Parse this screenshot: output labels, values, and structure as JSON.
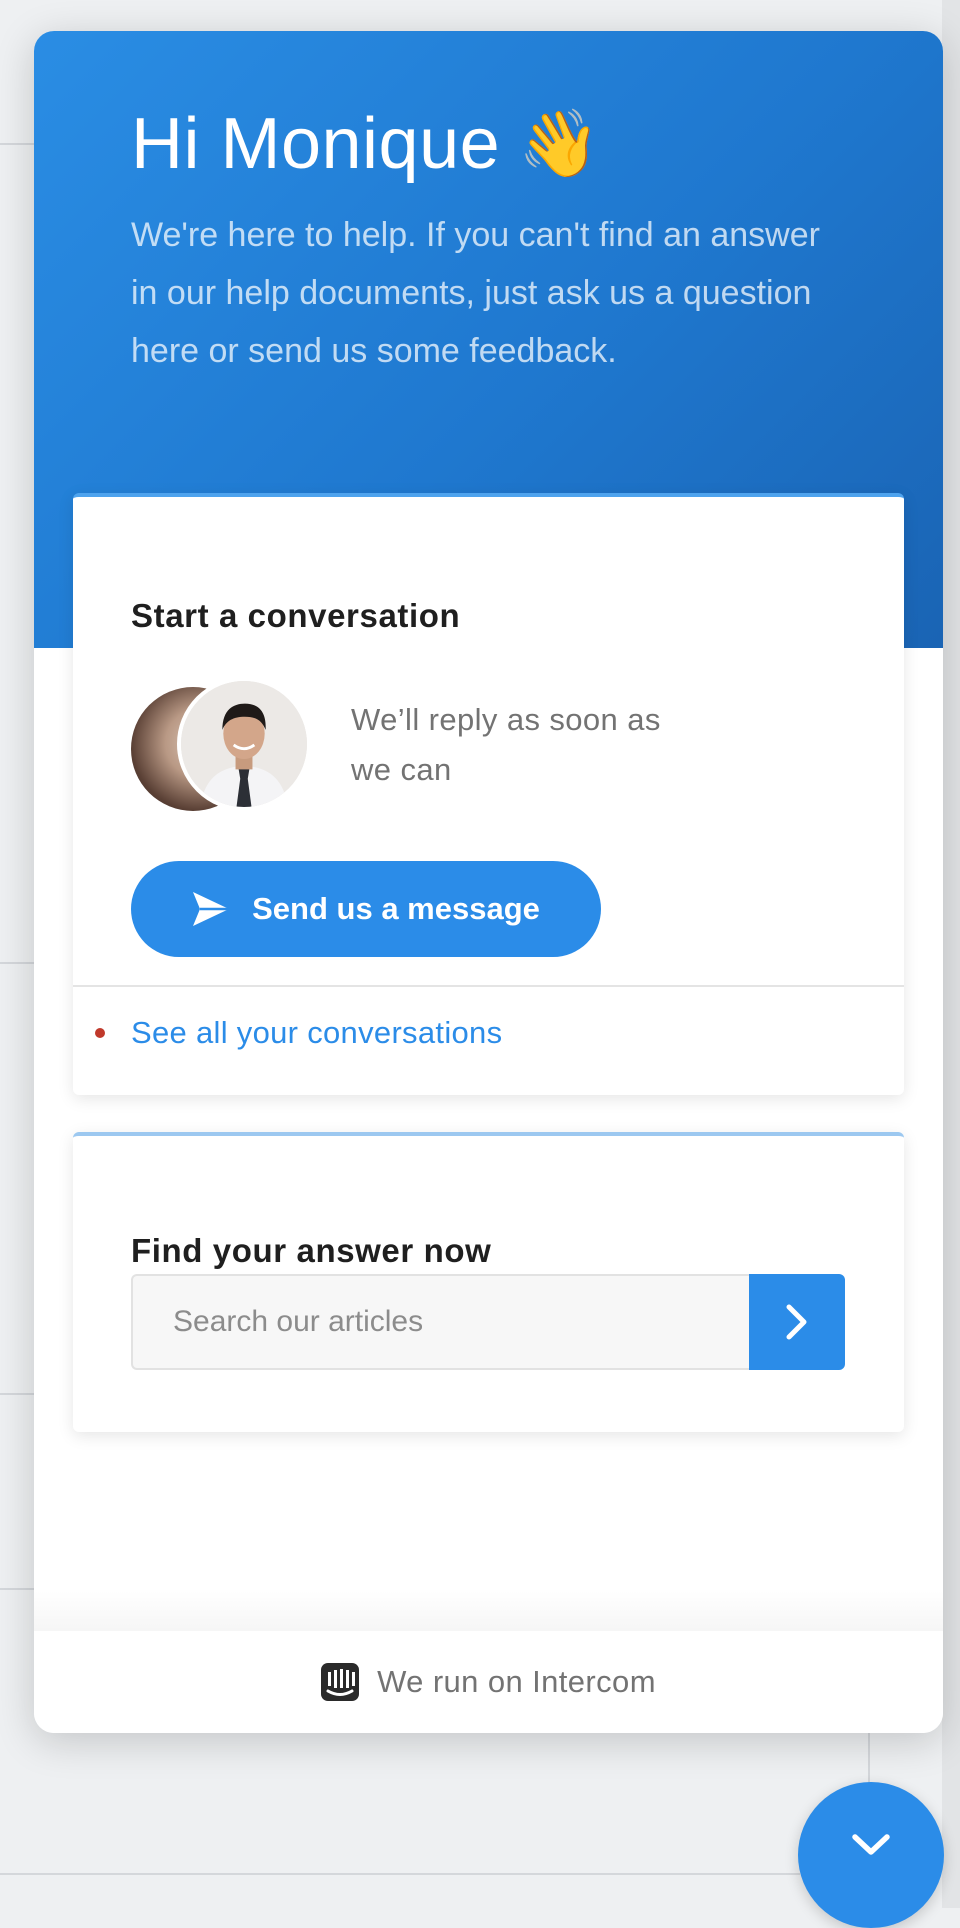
{
  "header": {
    "greeting": "Hi Monique",
    "wave_emoji": "👋",
    "intro": "We're here to help. If you can't find an answer in our help documents, just ask us a question here or send us some feedback."
  },
  "conversation_card": {
    "title": "Start a conversation",
    "reply_text": "We’ll reply as soon as we can",
    "send_button_label": "Send us a message",
    "send_icon": "paper-plane-icon",
    "see_all_label": "See all your conversations"
  },
  "search_card": {
    "title": "Find your answer now",
    "placeholder": "Search our articles",
    "submit_icon": "chevron-right-icon"
  },
  "footer": {
    "text": "We run on Intercom",
    "icon": "intercom-logo-icon"
  },
  "launcher": {
    "icon": "chevron-down-icon"
  },
  "colors": {
    "accent": "#2b8ce8",
    "header_gradient_start": "#2a8de4",
    "header_gradient_end": "#1a64b4",
    "unread_dot": "#c0392b"
  }
}
